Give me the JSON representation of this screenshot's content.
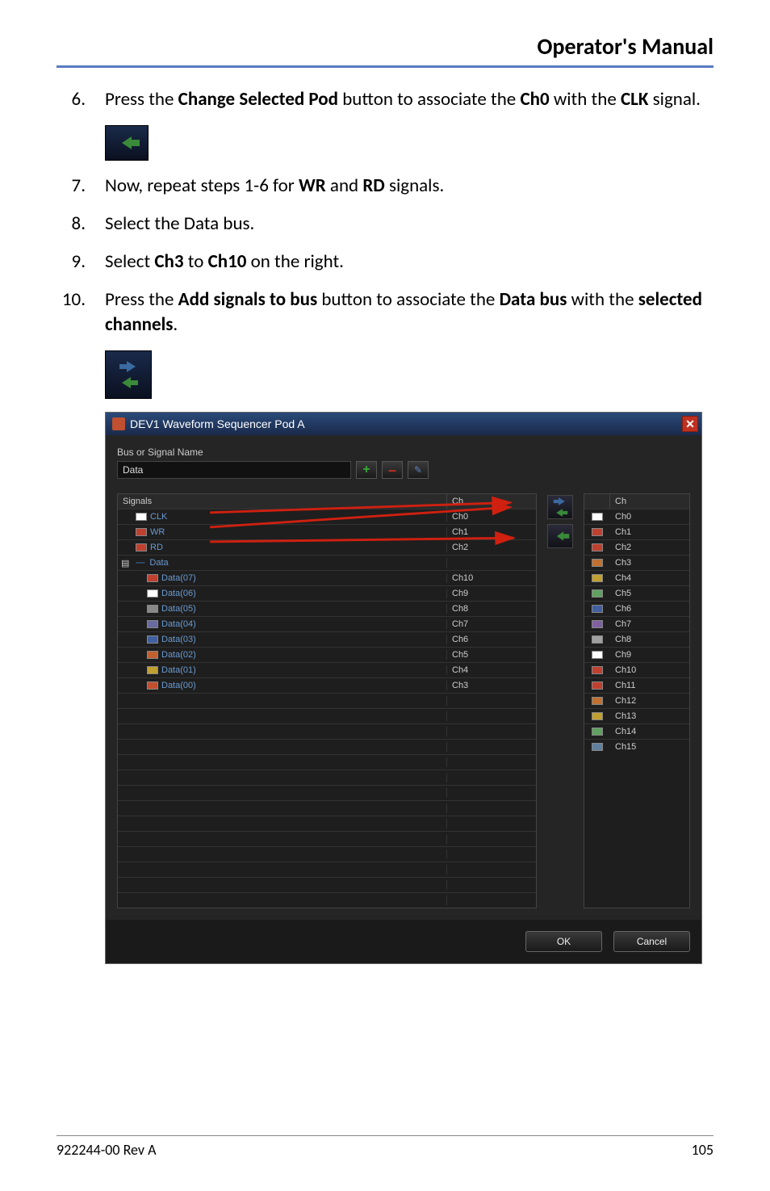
{
  "header": {
    "title": "Operator's Manual"
  },
  "steps": {
    "s6": {
      "num": "6.",
      "prefix": "Press the ",
      "b1": "Change Selected Pod",
      "mid1": " button to associate the ",
      "b2": "Ch0",
      "mid2": " with the ",
      "b3": "CLK",
      "suffix": " signal."
    },
    "s7": {
      "num": "7.",
      "prefix": "Now, repeat steps 1-6 for ",
      "b1": "WR",
      "mid1": " and ",
      "b2": "RD",
      "suffix": " signals."
    },
    "s8": {
      "num": "8.",
      "text": "Select the Data bus."
    },
    "s9": {
      "num": "9.",
      "prefix": "Select ",
      "b1": "Ch3",
      "mid1": " to ",
      "b2": "Ch10",
      "suffix": " on the right."
    },
    "s10": {
      "num": "10.",
      "prefix": "Press the ",
      "b1": "Add signals to bus",
      "mid1": " button to associate the ",
      "b2": "Data bus",
      "mid2": " with the ",
      "b3": "selected channels",
      "suffix": "."
    }
  },
  "dialog": {
    "title": "DEV1 Waveform Sequencer Pod A",
    "bus_label": "Bus or Signal Name",
    "bus_value": "Data",
    "plus": "+",
    "minus": "–",
    "edit": "✎",
    "left_headers": {
      "signals": "Signals",
      "ch": "Ch"
    },
    "signals": [
      {
        "name": "CLK",
        "ch": "Ch0",
        "color": "#ffffff",
        "indent": 1
      },
      {
        "name": "WR",
        "ch": "Ch1",
        "color": "#c04030",
        "indent": 1
      },
      {
        "name": "RD",
        "ch": "Ch2",
        "color": "#c04030",
        "indent": 1
      },
      {
        "name": "Data",
        "ch": "",
        "color": "#3a6aa0",
        "indent": 0,
        "group": true
      },
      {
        "name": "Data(07)",
        "ch": "Ch10",
        "color": "#c04030",
        "indent": 2
      },
      {
        "name": "Data(06)",
        "ch": "Ch9",
        "color": "#ffffff",
        "indent": 2
      },
      {
        "name": "Data(05)",
        "ch": "Ch8",
        "color": "#888888",
        "indent": 2
      },
      {
        "name": "Data(04)",
        "ch": "Ch7",
        "color": "#6a6aa0",
        "indent": 2
      },
      {
        "name": "Data(03)",
        "ch": "Ch6",
        "color": "#4060a0",
        "indent": 2
      },
      {
        "name": "Data(02)",
        "ch": "Ch5",
        "color": "#c06030",
        "indent": 2
      },
      {
        "name": "Data(01)",
        "ch": "Ch4",
        "color": "#c0a030",
        "indent": 2
      },
      {
        "name": "Data(00)",
        "ch": "Ch3",
        "color": "#c05030",
        "indent": 2
      }
    ],
    "empty_rows": 14,
    "right_header": "Ch",
    "channels": [
      {
        "name": "Ch0",
        "color": "#ffffff"
      },
      {
        "name": "Ch1",
        "color": "#c04030"
      },
      {
        "name": "Ch2",
        "color": "#c04030"
      },
      {
        "name": "Ch3",
        "color": "#c07030"
      },
      {
        "name": "Ch4",
        "color": "#c0a030"
      },
      {
        "name": "Ch5",
        "color": "#60a060"
      },
      {
        "name": "Ch6",
        "color": "#4060a0"
      },
      {
        "name": "Ch7",
        "color": "#8060a0"
      },
      {
        "name": "Ch8",
        "color": "#a0a0a0"
      },
      {
        "name": "Ch9",
        "color": "#ffffff"
      },
      {
        "name": "Ch10",
        "color": "#c04030"
      },
      {
        "name": "Ch11",
        "color": "#c04030"
      },
      {
        "name": "Ch12",
        "color": "#c07030"
      },
      {
        "name": "Ch13",
        "color": "#c0a030"
      },
      {
        "name": "Ch14",
        "color": "#60a060"
      },
      {
        "name": "Ch15",
        "color": "#6080a0"
      }
    ],
    "ok": "OK",
    "cancel": "Cancel"
  },
  "footer": {
    "left": "922244-00 Rev A",
    "right": "105"
  }
}
